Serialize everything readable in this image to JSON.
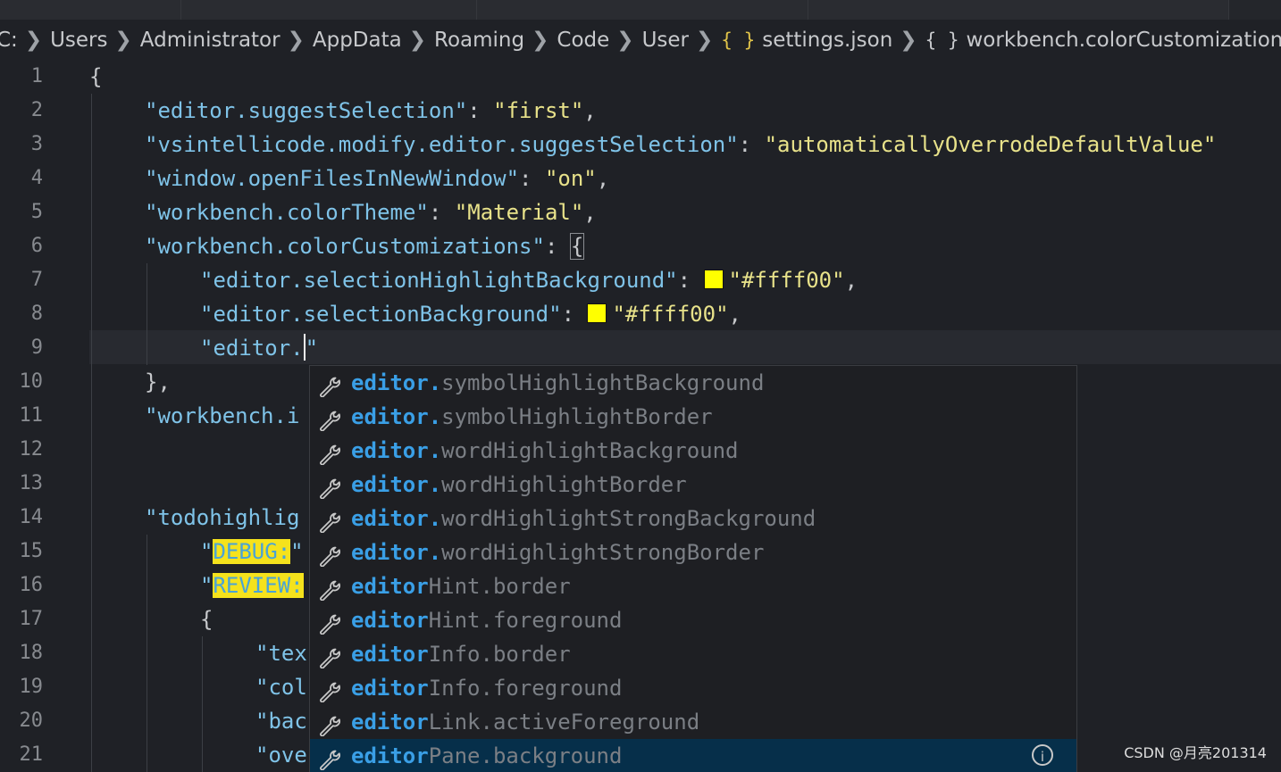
{
  "breadcrumb": {
    "items": [
      "C:",
      "Users",
      "Administrator",
      "AppData",
      "Roaming",
      "Code",
      "User",
      "settings.json",
      "workbench.colorCustomizations"
    ],
    "file_icon": "{ }",
    "object_icon": "{ }"
  },
  "editor": {
    "line_numbers": [
      "1",
      "2",
      "3",
      "4",
      "5",
      "6",
      "7",
      "8",
      "9",
      "10",
      "11",
      "12",
      "13",
      "14",
      "15",
      "16",
      "17",
      "18",
      "19",
      "20",
      "21"
    ],
    "lines": {
      "l1": "{",
      "l2_key": "\"editor.suggestSelection\"",
      "l2_val": "\"first\"",
      "l3_key": "\"vsintellicode.modify.editor.suggestSelection\"",
      "l3_val": "\"automaticallyOverrodeDefaultValue\"",
      "l4_key": "\"window.openFilesInNewWindow\"",
      "l4_val": "\"on\"",
      "l5_key": "\"workbench.colorTheme\"",
      "l5_val": "\"Material\"",
      "l6_key": "\"workbench.colorCustomizations\"",
      "l6_brace": "{",
      "l7_key": "\"editor.selectionHighlightBackground\"",
      "l7_val": "\"#ffff00\"",
      "l8_key": "\"editor.selectionBackground\"",
      "l8_val": "\"#ffff00\"",
      "l9_pre": "\"editor.",
      "l9_post": "\"",
      "l10": "},",
      "l11": "\"workbench.i",
      "l14": "\"todohighlig",
      "l15_q": "\"",
      "l15_tag": "DEBUG:",
      "l15_q2": "\"",
      "l16_q": "\"",
      "l16_tag": "REVIEW:",
      "l17": "{",
      "l18": "\"tex",
      "l19": "\"col",
      "l20": "\"bac",
      "l21": "\"ove"
    },
    "swatch_color": "#ffff00"
  },
  "suggestions": [
    {
      "match": "editor.",
      "rest": "symbolHighlightBackground",
      "icon": "wrench-icon"
    },
    {
      "match": "editor.",
      "rest": "symbolHighlightBorder",
      "icon": "wrench-icon"
    },
    {
      "match": "editor.",
      "rest": "wordHighlightBackground",
      "icon": "wrench-icon"
    },
    {
      "match": "editor.",
      "rest": "wordHighlightBorder",
      "icon": "wrench-icon"
    },
    {
      "match": "editor.",
      "rest": "wordHighlightStrongBackground",
      "icon": "wrench-icon"
    },
    {
      "match": "editor.",
      "rest": "wordHighlightStrongBorder",
      "icon": "wrench-icon"
    },
    {
      "match": "editor",
      "rest": "Hint.border",
      "icon": "wrench-icon"
    },
    {
      "match": "editor",
      "rest": "Hint.foreground",
      "icon": "wrench-icon"
    },
    {
      "match": "editor",
      "rest": "Info.border",
      "icon": "wrench-icon"
    },
    {
      "match": "editor",
      "rest": "Info.foreground",
      "icon": "wrench-icon"
    },
    {
      "match": "editor",
      "rest": "Link.activeForeground",
      "icon": "wrench-icon"
    },
    {
      "match": "editor",
      "rest": "Pane.background",
      "icon": "wrench-icon",
      "selected": true
    }
  ],
  "info_icon_label": "i",
  "watermark": "CSDN @月亮201314"
}
